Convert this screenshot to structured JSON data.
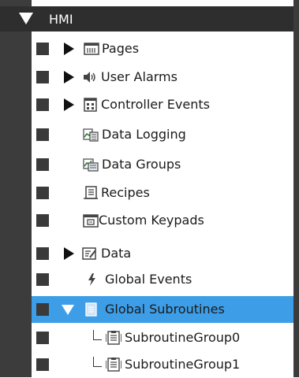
{
  "tree": {
    "root": {
      "label": "HMI",
      "icon": "collapse-arrow-icon"
    },
    "items": [
      {
        "label": "Pages",
        "icon": "pages-icon"
      },
      {
        "label": "User Alarms",
        "icon": "speaker-icon"
      },
      {
        "label": "Controller Events",
        "icon": "controller-events-icon"
      },
      {
        "label": "Data Logging",
        "icon": "data-logging-icon"
      },
      {
        "label": "Data Groups",
        "icon": "data-groups-icon"
      },
      {
        "label": "Recipes",
        "icon": "recipes-icon"
      },
      {
        "label": "Custom Keypads",
        "icon": "keypad-icon"
      },
      {
        "label": "Data",
        "icon": "data-icon"
      },
      {
        "label": "Global Events",
        "icon": "lightning-icon"
      },
      {
        "label": "Global Subroutines",
        "icon": "subroutines-icon",
        "selected": true
      },
      {
        "label": "SubroutineGroup0",
        "icon": "subroutine-group-icon"
      },
      {
        "label": "SubroutineGroup1",
        "icon": "subroutine-group-icon"
      }
    ]
  },
  "colors": {
    "selection": "#3d9ee7",
    "gutter": "#3c3c3c",
    "header": "#2e2e2e"
  }
}
